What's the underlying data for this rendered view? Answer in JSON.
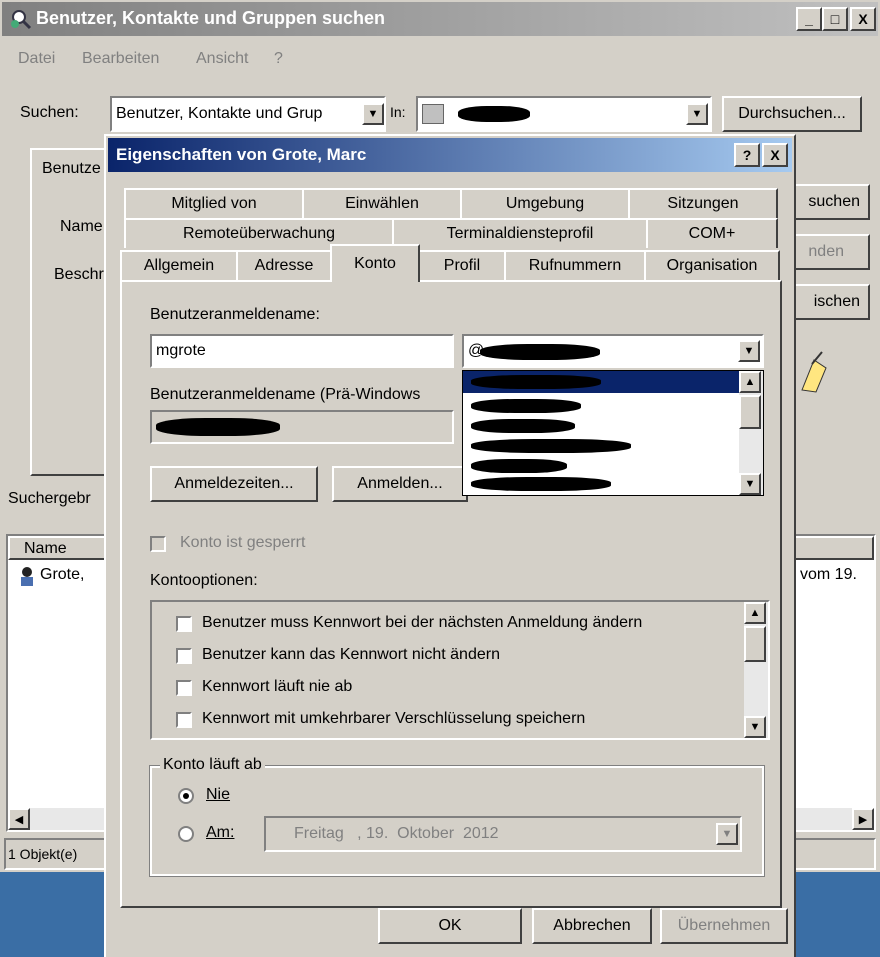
{
  "main_window": {
    "title": "Benutzer, Kontakte und Gruppen suchen",
    "controls": {
      "minimize": "_",
      "maximize": "□",
      "close": "X"
    },
    "menu": [
      "Datei",
      "Bearbeiten",
      "Ansicht",
      "?"
    ],
    "search_label": "Suchen:",
    "search_value": "Benutzer, Kontakte und Grup",
    "in_label": "In:",
    "browse_button": "Durchsuchen...",
    "tab_label": "Benutze",
    "name_label": "Name:",
    "descr_label": "Beschr",
    "search_now_button": "suchen",
    "stop_button": "nden",
    "clear_button": "ischen",
    "results_label": "Suchergebr",
    "list_col_name": "Name",
    "list_row_name": "Grote,",
    "list_row_desc": "vom 19.",
    "status": "1 Objekt(e)"
  },
  "dialog": {
    "title": "Eigenschaften von Grote, Marc",
    "help_button": "?",
    "close_button": "X",
    "tabs_row1": [
      "Mitglied von",
      "Einwählen",
      "Umgebung",
      "Sitzungen"
    ],
    "tabs_row2": [
      "Remoteüberwachung",
      "Terminaldiensteprofil",
      "COM+"
    ],
    "tabs_row3": [
      "Allgemein",
      "Adresse",
      "Konto",
      "Profil",
      "Rufnummern",
      "Organisation"
    ],
    "active_tab": "Konto",
    "logon_name_label": "Benutzeranmeldename:",
    "logon_name_value": "mgrote",
    "domain_prefix": "@",
    "prewin_label": "Benutzeranmeldename (Prä-Windows",
    "logon_hours_button": "Anmeldezeiten...",
    "logon_to_button": "Anmelden...",
    "locked_label": "Konto ist gesperrt",
    "options_label": "Kontooptionen:",
    "options": [
      "Benutzer muss Kennwort bei der nächsten Anmeldung ändern",
      "Benutzer kann das Kennwort nicht ändern",
      "Kennwort läuft nie ab",
      "Kennwort mit umkehrbarer Verschlüsselung speichern"
    ],
    "expires_group": "Konto läuft ab",
    "never_label": "Nie",
    "at_label": "Am:",
    "date_value": "Freitag   , 19.  Oktober  2012",
    "ok_button": "OK",
    "cancel_button": "Abbrechen",
    "apply_button": "Übernehmen"
  }
}
